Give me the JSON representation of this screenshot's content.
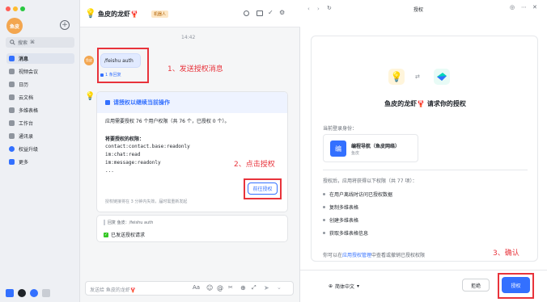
{
  "sidebar": {
    "avatar": "鱼皮",
    "search": {
      "label": "搜索",
      "shortcut": "⌘"
    },
    "items": [
      {
        "label": "消息",
        "active": true
      },
      {
        "label": "视频会议"
      },
      {
        "label": "日历"
      },
      {
        "label": "云文档"
      },
      {
        "label": "多维表格"
      },
      {
        "label": "工作台"
      },
      {
        "label": "通讯录"
      },
      {
        "label": "权益升级"
      },
      {
        "label": "更多"
      }
    ]
  },
  "chat": {
    "title": "鱼皮的龙虾🦞",
    "badge": "机器人",
    "time": "14:42",
    "user_message": "/feishu auth",
    "reply_count": "1 条回复",
    "annotation1": "1、发送授权消息",
    "card": {
      "title": "请授权以继续当前操作",
      "desc": "应用需要授权 76 个用户权限（共 76 个，已授权 0 个）。",
      "perm_title": "将要授权的权限：",
      "perms": [
        "contact:contact.base:readonly",
        "im:chat:read",
        "im:message:readonly",
        "..."
      ],
      "button": "前往授权",
      "footnote": "授权链接将在 3 分钟内失效，届时需重新发起"
    },
    "annotation2": "2、点击授权",
    "reply_quote": "回复 鱼皮：/feishu auth",
    "reply_text": "已发送授权请求",
    "input_placeholder": "发送给 鱼皮的龙虾🦞"
  },
  "auth": {
    "window_title": "授权",
    "heading": "鱼皮的龙虾🦞 请求你的授权",
    "login_label": "当前登录身份：",
    "account_icon": "编",
    "account_name": "编程导航（鱼皮网络）",
    "account_sub": "鱼皮",
    "after_label": "授权后，应用将获得以下权限（共 77 项）：",
    "perms": [
      "在用户离线时访问已授权数据",
      "复制多维表格",
      "创建多维表格",
      "获取多维表格信息"
    ],
    "manage_prefix": "你可以在",
    "manage_link": "应用授权管理",
    "manage_suffix": "中查看或撤销已授权权限",
    "annotation3": "3、确认",
    "lang": "简体中文",
    "reject": "拒绝",
    "confirm": "授权"
  },
  "colors": {
    "accent": "#3370ff",
    "annotation": "#e8333b"
  }
}
